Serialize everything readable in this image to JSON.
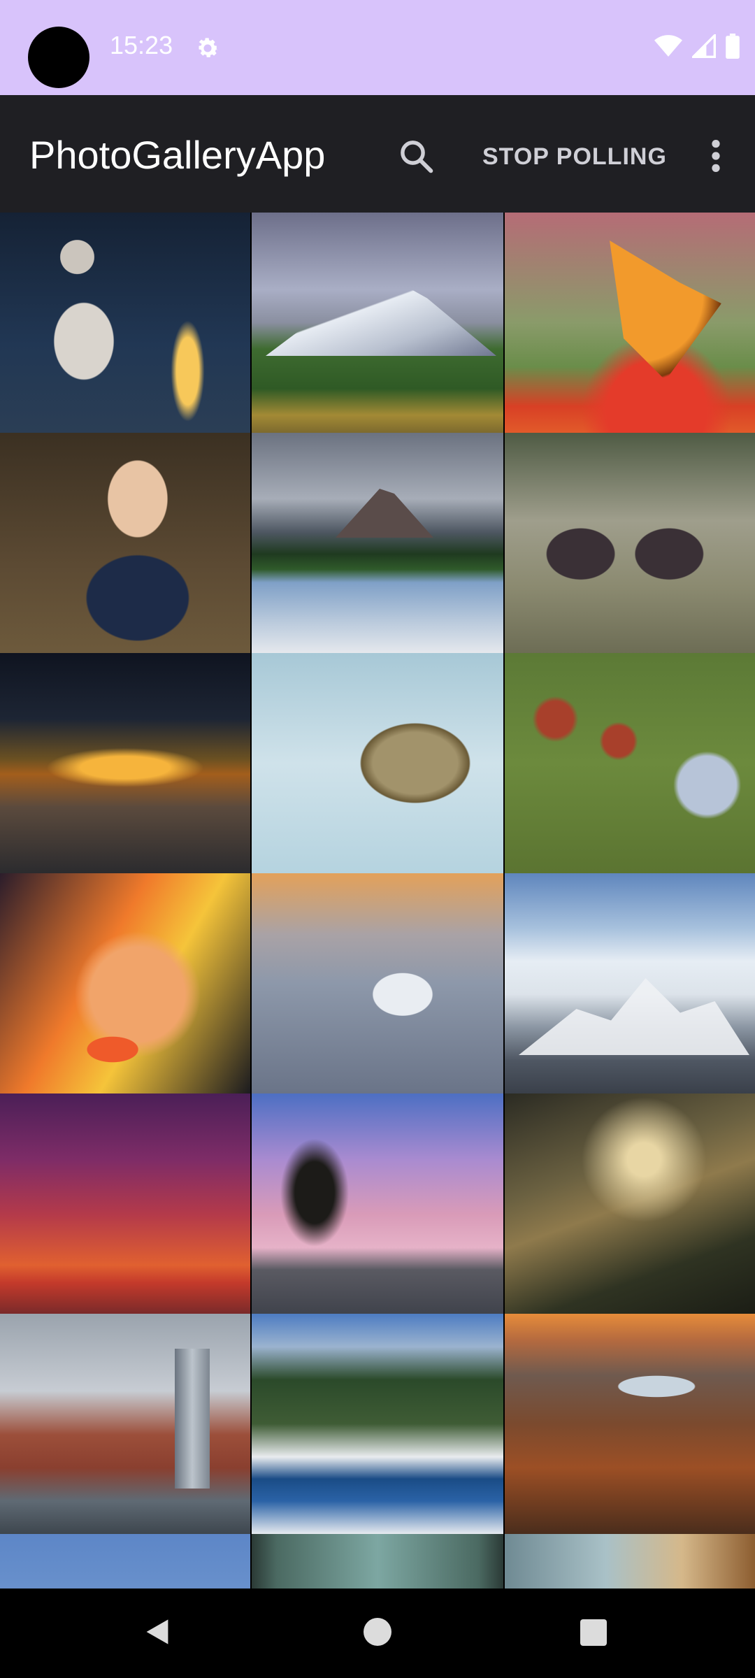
{
  "status_bar": {
    "time": "15:23",
    "icons": [
      "gear-icon",
      "wifi-icon",
      "signal-icon",
      "battery-icon"
    ],
    "background": "#d8c3fb"
  },
  "app_bar": {
    "title": "PhotoGalleryApp",
    "action_label": "STOP POLLING",
    "icons": [
      "search-icon",
      "more-vert-icon"
    ],
    "background": "#1f1f23"
  },
  "gallery": {
    "columns": 3,
    "photos": [
      "statue-eiffel-tower",
      "snowy-mountain-forest",
      "orange-butterfly-flowers",
      "woman-pearl-portrait",
      "mountain-lake-reflection",
      "chamois-meadow",
      "sunset-clouds-mountains",
      "vulture-flight",
      "butterfly-wildflowers",
      "face-paint-portrait",
      "seagull-water",
      "alpine-peaks-clouds",
      "purple-red-sunset",
      "tree-pink-sky",
      "sunrays-forest-path",
      "city-skyline-river",
      "snowy-river-pines",
      "canyon-river-sunset",
      "golden-dome-sky",
      "window-interior",
      "interior-piano-stairs"
    ]
  },
  "nav_bar": {
    "buttons": [
      "back",
      "home",
      "recents"
    ]
  }
}
